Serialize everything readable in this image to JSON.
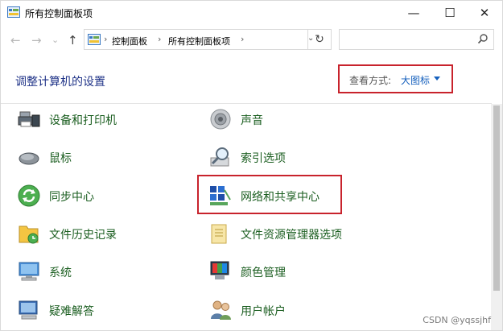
{
  "window": {
    "title": "所有控制面板项",
    "controls": {
      "minimize": "—",
      "maximize": "☐",
      "close": "✕"
    }
  },
  "nav": {
    "back": "←",
    "forward": "→",
    "recent": "⌄",
    "up": "↑",
    "breadcrumb": [
      "控制面板",
      "所有控制面板项"
    ],
    "separator": "›",
    "dropdown": "⌄",
    "refresh": "↻",
    "search_placeholder": ""
  },
  "heading": "调整计算机的设置",
  "view": {
    "label": "查看方式:",
    "value": "大图标"
  },
  "items": [
    {
      "label": "设备和打印机",
      "icon": "printer-icon"
    },
    {
      "label": "声音",
      "icon": "speaker-icon"
    },
    {
      "label": "鼠标",
      "icon": "mouse-icon"
    },
    {
      "label": "索引选项",
      "icon": "indexing-icon"
    },
    {
      "label": "同步中心",
      "icon": "sync-icon"
    },
    {
      "label": "网络和共享中心",
      "icon": "network-icon"
    },
    {
      "label": "文件历史记录",
      "icon": "file-history-icon"
    },
    {
      "label": "文件资源管理器选项",
      "icon": "explorer-options-icon"
    },
    {
      "label": "系统",
      "icon": "system-icon"
    },
    {
      "label": "颜色管理",
      "icon": "color-management-icon"
    },
    {
      "label": "疑难解答",
      "icon": "troubleshooting-icon"
    },
    {
      "label": "用户帐户",
      "icon": "user-accounts-icon"
    }
  ],
  "watermark": "CSDN @yqssjhf",
  "colors": {
    "accent": "#1560bd",
    "highlight": "#c8232c",
    "item_text": "#1b5e20",
    "heading": "#1e3287"
  }
}
